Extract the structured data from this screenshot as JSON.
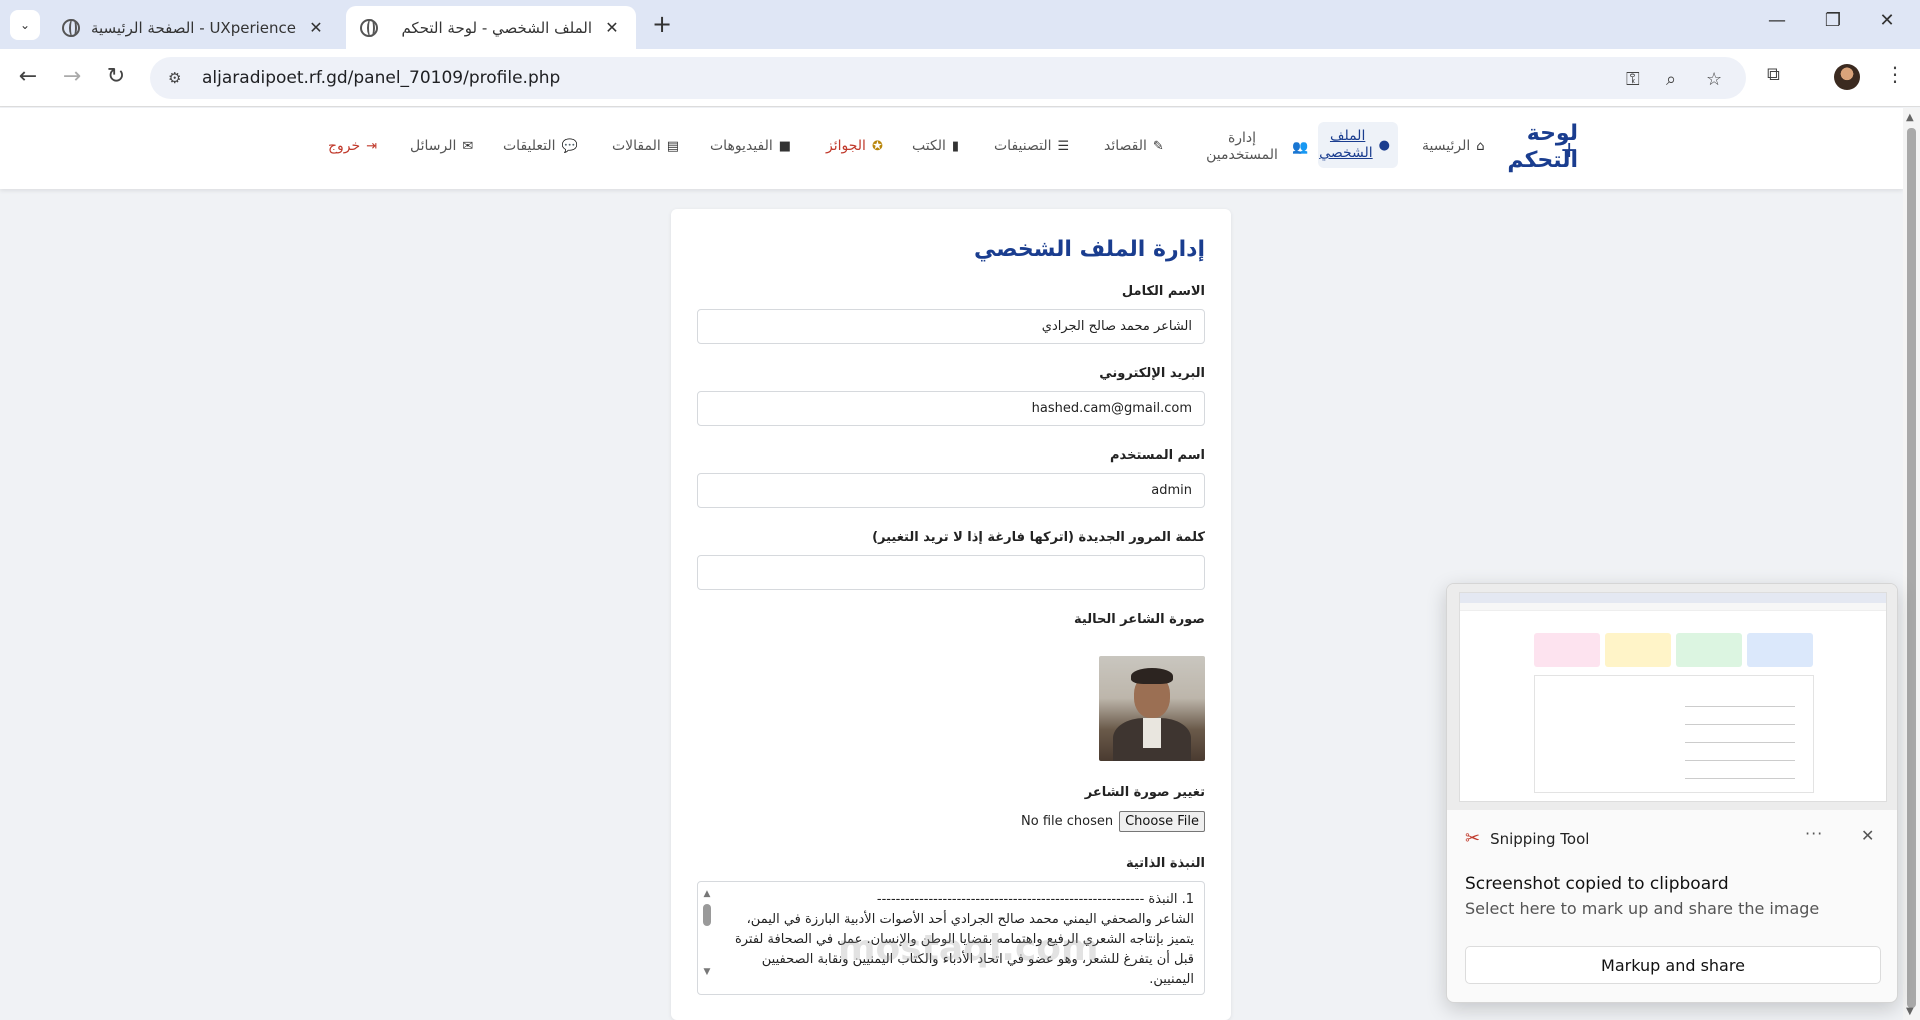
{
  "browser": {
    "tabs": [
      {
        "title": "UXperience - الصفحة الرئيسية"
      },
      {
        "title": "الملف الشخصي - لوحة التحكم"
      }
    ],
    "url": "aljaradipoet.rf.gd/panel_70109/profile.php"
  },
  "nav": {
    "brand": "لوحة التحكم",
    "items": [
      {
        "label": "الرئيسية",
        "icon": "home-icon"
      },
      {
        "label": "الملف الشخصي",
        "icon": "user-icon"
      },
      {
        "label": "إدارة المستخدمين",
        "icon": "users-icon"
      },
      {
        "label": "القصائد",
        "icon": "feather-icon"
      },
      {
        "label": "التصنيفات",
        "icon": "list-icon"
      },
      {
        "label": "الكتب",
        "icon": "book-icon"
      },
      {
        "label": "الجوائز",
        "icon": "award-icon"
      },
      {
        "label": "الفيديوهات",
        "icon": "video-icon"
      },
      {
        "label": "المقالات",
        "icon": "newspaper-icon"
      },
      {
        "label": "التعليقات",
        "icon": "comments-icon"
      },
      {
        "label": "الرسائل",
        "icon": "envelope-icon"
      },
      {
        "label": "خروج",
        "icon": "logout-icon"
      }
    ]
  },
  "form": {
    "heading": "إدارة الملف الشخصي",
    "fullname_label": "الاسم الكامل",
    "fullname_value": "الشاعر محمد صالح الجرادي",
    "email_label": "البريد الإلكتروني",
    "email_value": "hashed.cam@gmail.com",
    "username_label": "اسم المستخدم",
    "username_value": "admin",
    "password_label": "كلمة المرور الجديدة (اتركها فارغة إذا لا تريد التغيير)",
    "password_value": "",
    "photo_label": "صورة الشاعر الحالية",
    "change_photo_label": "تغيير صورة الشاعر",
    "file_status": "No file chosen",
    "choose_file": "Choose File",
    "bio_label": "النبذة الذاتية",
    "bio_lines": [
      "1. النبذة ---------------------------------------------------------",
      "الشاعر والصحفي اليمني محمد صالح الجرادي أحد الأصوات الأدبية البارزة في اليمن،",
      "يتميز بإنتاجه الشعري الرفيع واهتمامه بقضايا الوطن والإنسان. عمل في الصحافة لفترة",
      "قبل أن يتفرغ للشعر، وهو عضو في اتحاد الأدباء والكتاب اليمنيين ونقابة الصحفيين",
      "اليمنيين."
    ]
  },
  "watermark": "mostaql.com",
  "snipping": {
    "app": "Snipping Tool",
    "title": "Screenshot copied to clipboard",
    "subtitle": "Select here to mark up and share the image",
    "button": "Markup and share"
  }
}
